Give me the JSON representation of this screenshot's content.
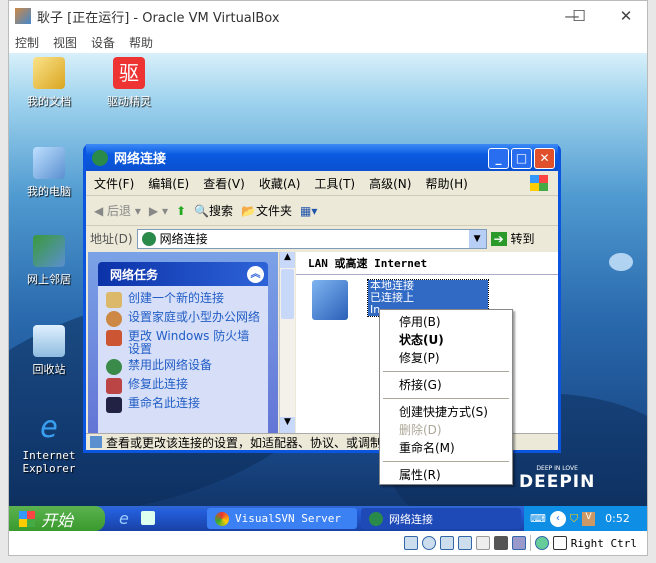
{
  "vbox": {
    "title": "耿子 [正在运行] - Oracle VM VirtualBox",
    "menu": [
      "控制",
      "视图",
      "设备",
      "帮助"
    ],
    "status_hostkey": "Right Ctrl"
  },
  "desktop": {
    "icons": [
      {
        "label": "我的文档"
      },
      {
        "label": "驱动精灵",
        "glyph": "驱"
      },
      {
        "label": "我的电脑"
      },
      {
        "label": "网上邻居"
      },
      {
        "label": "回收站"
      },
      {
        "label": "Internet Explorer"
      }
    ],
    "logo": "DEEPIN",
    "logo_tag": "DEEP IN LOVE"
  },
  "window": {
    "title": "网络连接",
    "menu": [
      "文件(F)",
      "编辑(E)",
      "查看(V)",
      "收藏(A)",
      "工具(T)",
      "高级(N)",
      "帮助(H)"
    ],
    "toolbar": {
      "back": "后退",
      "search": "搜索",
      "folders": "文件夹"
    },
    "address": {
      "label": "地址(D)",
      "value": "网络连接",
      "go": "转到"
    },
    "tasks_title": "网络任务",
    "tasks": [
      "创建一个新的连接",
      "设置家庭或小型办公网络",
      "更改 Windows 防火墙设置",
      "禁用此网络设备",
      "修复此连接",
      "重命名此连接"
    ],
    "group_header": "LAN 或高速 Internet",
    "connection": {
      "name": "本地连接",
      "status": "已连接上",
      "type": "In"
    },
    "status_text": "查看或更改该连接的设置，如适配器、协议、或调制"
  },
  "context_menu": [
    {
      "label": "停用(B)"
    },
    {
      "label": "状态(U)",
      "bold": true
    },
    {
      "label": "修复(P)"
    },
    {
      "sep": true
    },
    {
      "label": "桥接(G)"
    },
    {
      "sep": true
    },
    {
      "label": "创建快捷方式(S)"
    },
    {
      "label": "删除(D)",
      "disabled": true
    },
    {
      "label": "重命名(M)"
    },
    {
      "sep": true
    },
    {
      "label": "属性(R)"
    }
  ],
  "taskbar": {
    "start": "开始",
    "tasks": [
      "VisualSVN Server",
      "网络连接"
    ],
    "clock": "0:52"
  }
}
